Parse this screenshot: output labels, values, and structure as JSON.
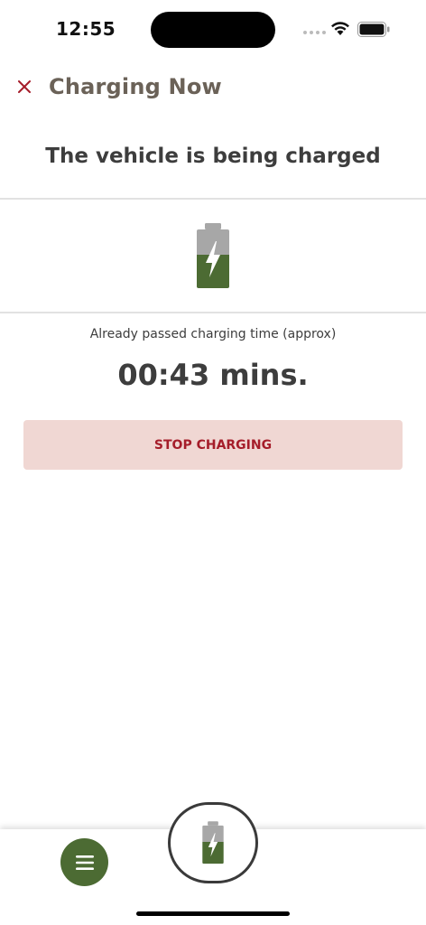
{
  "status_bar": {
    "time": "12:55"
  },
  "header": {
    "close_icon": "close-icon",
    "title": "Charging Now"
  },
  "main": {
    "subtitle": "The vehicle is being charged",
    "battery_icon": "battery-charging-icon",
    "elapsed_label": "Already passed charging time (approx)",
    "elapsed_value": "00:43 mins.",
    "stop_label": "STOP CHARGING"
  },
  "bottom_nav": {
    "menu_icon": "menu-icon",
    "charge_icon": "battery-charging-icon"
  },
  "colors": {
    "accent_red": "#a51d2a",
    "stop_bg": "#f0d7d3",
    "battery_green": "#4c6b33",
    "battery_gray": "#a7a7a7",
    "title_brown": "#6b6258"
  }
}
